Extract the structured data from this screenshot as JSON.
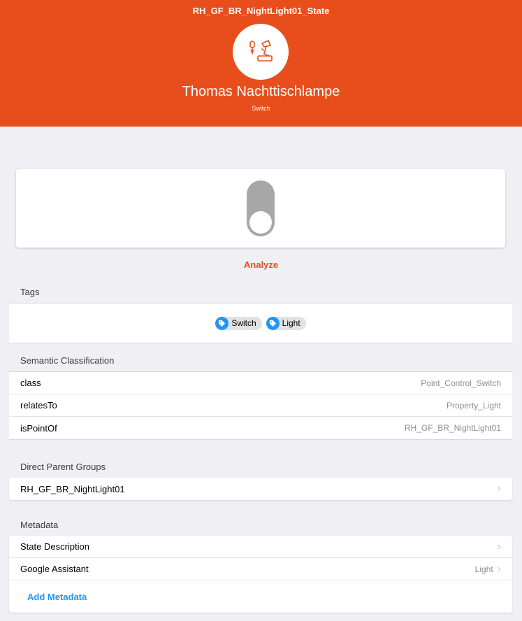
{
  "header": {
    "item_name": "RH_GF_BR_NightLight01_State",
    "item_label": "Thomas Nachttischlampe",
    "item_type": "Switch",
    "icon": "lamp-icon"
  },
  "control": {
    "state": "OFF"
  },
  "analyze_label": "Analyze",
  "tags": {
    "title": "Tags",
    "items": [
      {
        "label": "Switch",
        "icon": "tag-icon"
      },
      {
        "label": "Light",
        "icon": "tag-icon"
      }
    ]
  },
  "semantic": {
    "title": "Semantic Classification",
    "rows": [
      {
        "label": "class",
        "value": "Point_Control_Switch"
      },
      {
        "label": "relatesTo",
        "value": "Property_Light"
      },
      {
        "label": "isPointOf",
        "value": "RH_GF_BR_NightLight01"
      }
    ]
  },
  "parents": {
    "title": "Direct Parent Groups",
    "rows": [
      {
        "label": "RH_GF_BR_NightLight01"
      }
    ]
  },
  "metadata": {
    "title": "Metadata",
    "rows": [
      {
        "label": "State Description",
        "value": ""
      },
      {
        "label": "Google Assistant",
        "value": "Light"
      }
    ],
    "add_label": "Add Metadata"
  },
  "colors": {
    "accent": "#e84e1b",
    "link": "#2196f3",
    "toggle_off": "#a7a7a7"
  }
}
